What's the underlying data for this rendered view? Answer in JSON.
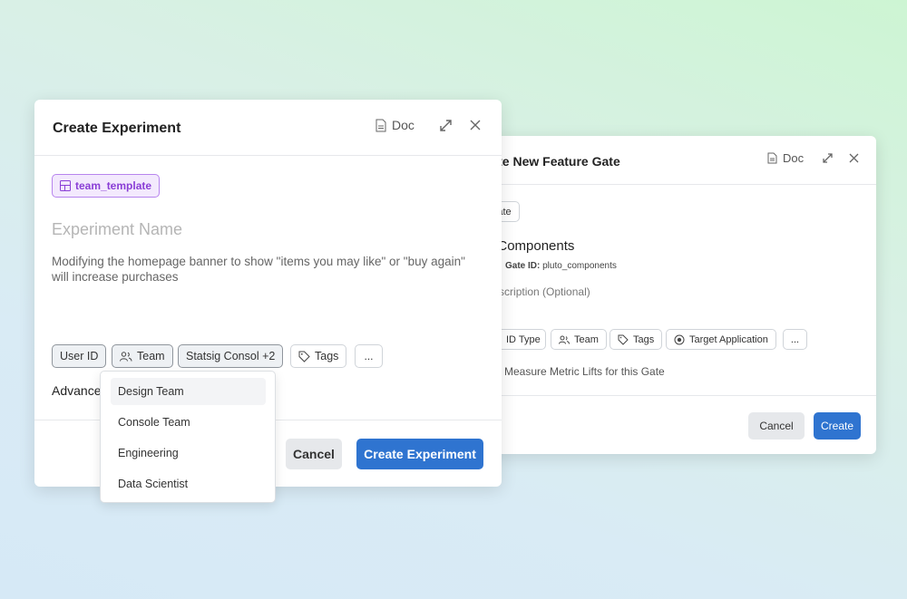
{
  "back_dialog": {
    "title": "Create New Feature Gate",
    "doc_label": "Doc",
    "template_chip": "Template",
    "gate_name": "Pluto Components",
    "gate_id_label": "Gate ID:",
    "gate_id_value": "pluto_components",
    "description_placeholder": "Add Description (Optional)",
    "chips": [
      "ID Type",
      "Team",
      "Tags",
      "Target Application",
      "..."
    ],
    "metric_lifts_label": "Measure Metric Lifts for this Gate",
    "cancel_label": "Cancel",
    "create_label": "Create"
  },
  "front_dialog": {
    "title": "Create Experiment",
    "doc_label": "Doc",
    "template_chip": "team_template",
    "name_placeholder": "Experiment Name",
    "hypothesis": "Modifying the homepage banner to show \"items you may like\" or \"buy again\" will increase purchases",
    "chips": [
      "User ID",
      "Team",
      "Statsig Consol +2",
      "Tags",
      "..."
    ],
    "advanced_label": "Advanced",
    "cancel_label": "Cancel",
    "create_label": "Create Experiment",
    "team_dropdown": [
      "Design Team",
      "Console Team",
      "Engineering",
      "Data Scientist"
    ]
  },
  "colors": {
    "primary": "#2f74d0",
    "template_purple": "#8a3ed6"
  }
}
